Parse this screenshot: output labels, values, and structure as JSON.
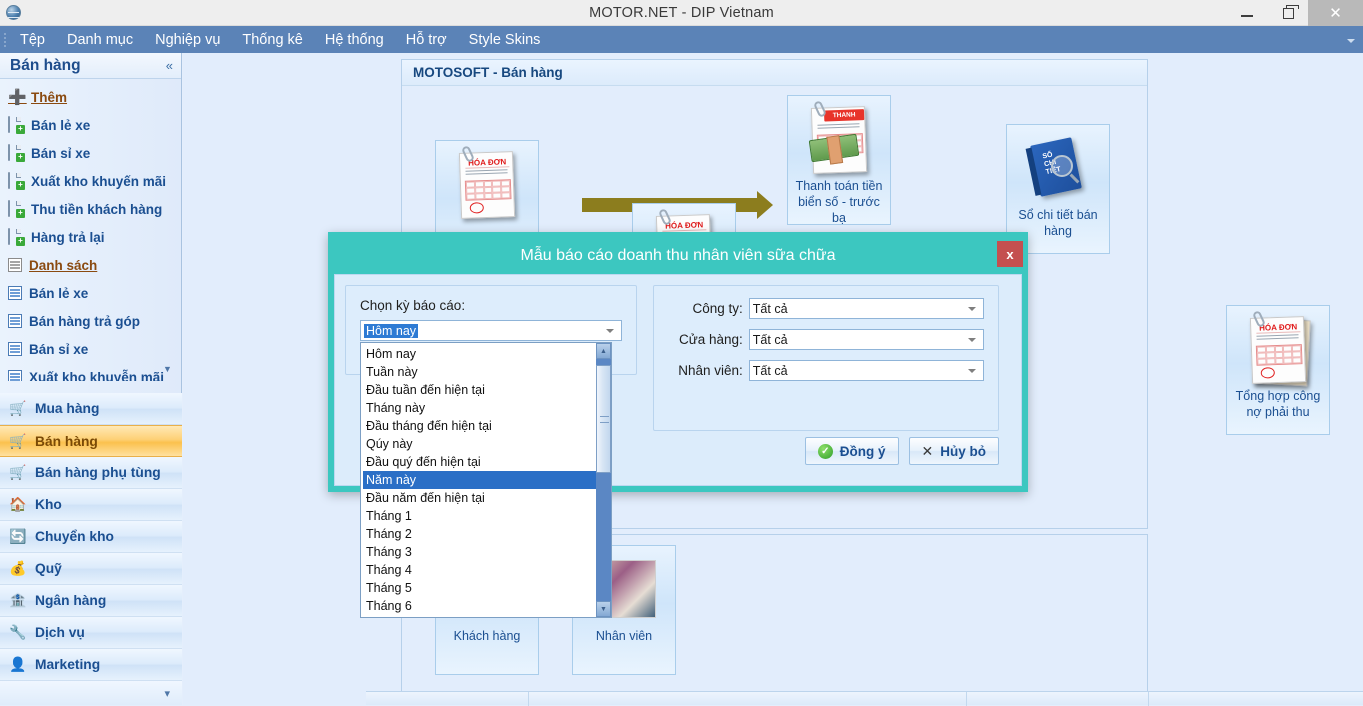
{
  "window": {
    "title": "MOTOR.NET - DIP Vietnam",
    "logo_icon": "globe-icon",
    "minimize_label": "–",
    "maximize_label": "❐",
    "close_label": "✕"
  },
  "menubar": {
    "items": [
      {
        "label": "Tệp"
      },
      {
        "label": "Danh mục"
      },
      {
        "label": "Nghiệp vụ"
      },
      {
        "label": "Thống kê"
      },
      {
        "label": "Hệ thống"
      },
      {
        "label": "Hỗ trợ"
      },
      {
        "label": "Style Skins"
      }
    ],
    "overflow_icon": "chevron-down-icon"
  },
  "sidebar": {
    "header": {
      "title": "Bán hàng",
      "collapse_icon": "«"
    },
    "items": [
      {
        "label": "Thêm",
        "icon": "plus-icon",
        "style": "link"
      },
      {
        "label": "Bán lẻ xe",
        "icon": "doc-add-icon"
      },
      {
        "label": "Bán sỉ xe",
        "icon": "doc-add-icon"
      },
      {
        "label": "Xuất kho khuyến mãi",
        "icon": "doc-add-icon"
      },
      {
        "label": "Thu tiền khách hàng",
        "icon": "doc-add-icon"
      },
      {
        "label": "Hàng trả lại",
        "icon": "doc-add-icon"
      },
      {
        "label": "Danh sách",
        "icon": "list-icon",
        "style": "link"
      },
      {
        "label": "Bán lẻ xe",
        "icon": "grid-icon"
      },
      {
        "label": "Bán hàng trả góp",
        "icon": "grid-icon"
      },
      {
        "label": "Bán sỉ xe",
        "icon": "grid-icon"
      },
      {
        "label": "Xuất kho khuyễn mãi",
        "icon": "grid-icon"
      }
    ],
    "modules": [
      {
        "label": "Mua hàng",
        "icon": "cart-add-icon",
        "active": false
      },
      {
        "label": "Bán hàng",
        "icon": "cart-icon",
        "active": true
      },
      {
        "label": "Bán hàng phụ tùng",
        "icon": "cart-icon",
        "active": false
      },
      {
        "label": "Kho",
        "icon": "house-icon",
        "active": false
      },
      {
        "label": "Chuyển kho",
        "icon": "transfer-icon",
        "active": false
      },
      {
        "label": "Quỹ",
        "icon": "coins-icon",
        "active": false
      },
      {
        "label": "Ngân hàng",
        "icon": "bank-icon",
        "active": false
      },
      {
        "label": "Dịch vụ",
        "icon": "wrench-icon",
        "active": false
      },
      {
        "label": "Marketing",
        "icon": "person-icon",
        "active": false
      }
    ],
    "expand_icon": "chevron-down-icon"
  },
  "main": {
    "panel_title": "MOTOSOFT - Bán hàng",
    "tiles": [
      {
        "label": "",
        "icon": "invoice-icon"
      },
      {
        "label": "",
        "icon": "invoice-icon"
      },
      {
        "label": "Thanh toán tiền biển số - trước bạ",
        "icon": "payment-icon"
      },
      {
        "label": "Sổ chi tiết bán hàng",
        "icon": "book-search-icon"
      },
      {
        "label": "Tổng hợp công nợ phải thu",
        "icon": "invoice-stack-icon"
      },
      {
        "label": "Khách hàng",
        "icon": "customer-icon"
      },
      {
        "label": "Nhân viên",
        "icon": "staff-icon"
      }
    ]
  },
  "dialog": {
    "title": "Mẫu báo cáo doanh thu nhân viên sữa chữa",
    "close_label": "x",
    "close_icon": "close-icon",
    "period": {
      "label": "Chọn kỳ báo cáo:",
      "value": "Hôm nay",
      "dropdown_icon": "chevron-down-icon"
    },
    "filters": [
      {
        "label": "Công ty:",
        "value": "Tất cả"
      },
      {
        "label": "Cửa hàng:",
        "value": "Tất cả"
      },
      {
        "label": "Nhân viên:",
        "value": "Tất cả"
      }
    ],
    "buttons": {
      "ok": {
        "label": "Đồng ý",
        "icon": "check-circle-icon"
      },
      "cancel": {
        "label": "Hủy bỏ",
        "icon": "x-icon"
      }
    }
  },
  "dropdown": {
    "selected": "Năm này",
    "scroll_up_icon": "▲",
    "scroll_down_icon": "▼",
    "items": [
      {
        "label": "Hôm nay"
      },
      {
        "label": "Tuần này"
      },
      {
        "label": "Đầu tuần đến hiện tại"
      },
      {
        "label": "Tháng này"
      },
      {
        "label": "Đầu tháng đến hiện tại"
      },
      {
        "label": "Qúy này"
      },
      {
        "label": "Đầu quý đến hiện tại"
      },
      {
        "label": "Năm này",
        "selected": true
      },
      {
        "label": "Đầu năm đến hiện tại"
      },
      {
        "label": "Tháng 1"
      },
      {
        "label": "Tháng 2"
      },
      {
        "label": "Tháng 3"
      },
      {
        "label": "Tháng 4"
      },
      {
        "label": "Tháng 5"
      },
      {
        "label": "Tháng 6"
      }
    ]
  },
  "colors": {
    "accent_teal": "#3cc7c0",
    "menubar_blue": "#5b83b7",
    "sidebar_active": "#fbc14d",
    "close_red": "#c45050",
    "selection_blue": "#2b6fc6"
  }
}
